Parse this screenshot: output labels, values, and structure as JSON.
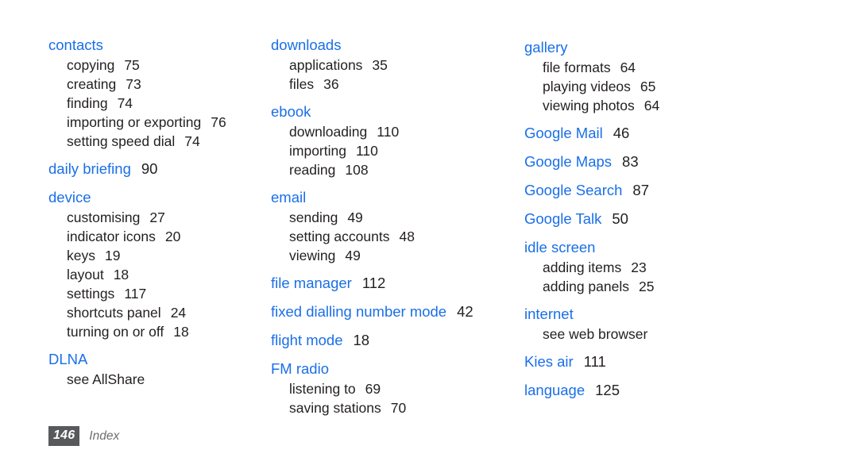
{
  "document": {
    "page_number": "146",
    "section_label": "Index",
    "heading_color": "#1a6fe8",
    "body_color": "#231f20",
    "folio_badge_color": "#58595b",
    "folio_label_color": "#6d6e71",
    "background_color": "#ffffff"
  },
  "columns": [
    {
      "id": "column-1",
      "entries": [
        {
          "type": "heading",
          "label": "contacts",
          "page": ""
        },
        {
          "type": "sub",
          "label": "copying",
          "page": "75"
        },
        {
          "type": "sub",
          "label": "creating",
          "page": "73"
        },
        {
          "type": "sub",
          "label": "finding",
          "page": "74"
        },
        {
          "type": "sub",
          "label": "importing or exporting",
          "page": "76"
        },
        {
          "type": "sub",
          "label": "setting speed dial",
          "page": "74"
        },
        {
          "type": "heading",
          "label": "daily briefing",
          "page": "90"
        },
        {
          "type": "heading",
          "label": "device",
          "page": ""
        },
        {
          "type": "sub",
          "label": "customising",
          "page": "27"
        },
        {
          "type": "sub",
          "label": "indicator icons",
          "page": "20"
        },
        {
          "type": "sub",
          "label": "keys",
          "page": "19"
        },
        {
          "type": "sub",
          "label": "layout",
          "page": "18"
        },
        {
          "type": "sub",
          "label": "settings",
          "page": "117"
        },
        {
          "type": "sub",
          "label": "shortcuts panel",
          "page": "24"
        },
        {
          "type": "sub",
          "label": "turning on or off",
          "page": "18"
        },
        {
          "type": "heading",
          "label": "DLNA",
          "page": ""
        },
        {
          "type": "sub",
          "label": "see AllShare",
          "page": ""
        }
      ]
    },
    {
      "id": "column-2",
      "entries": [
        {
          "type": "heading",
          "label": "downloads",
          "page": ""
        },
        {
          "type": "sub",
          "label": "applications",
          "page": "35"
        },
        {
          "type": "sub",
          "label": "files",
          "page": "36"
        },
        {
          "type": "heading",
          "label": "ebook",
          "page": ""
        },
        {
          "type": "sub",
          "label": "downloading",
          "page": "110"
        },
        {
          "type": "sub",
          "label": "importing",
          "page": "110"
        },
        {
          "type": "sub",
          "label": "reading",
          "page": "108"
        },
        {
          "type": "heading",
          "label": "email",
          "page": ""
        },
        {
          "type": "sub",
          "label": "sending",
          "page": "49"
        },
        {
          "type": "sub",
          "label": "setting accounts",
          "page": "48"
        },
        {
          "type": "sub",
          "label": "viewing",
          "page": "49"
        },
        {
          "type": "heading",
          "label": "file manager",
          "page": "112"
        },
        {
          "type": "heading",
          "label": "fixed dialling number mode",
          "page": "42"
        },
        {
          "type": "heading",
          "label": "flight mode",
          "page": "18"
        },
        {
          "type": "heading",
          "label": "FM radio",
          "page": ""
        },
        {
          "type": "sub",
          "label": "listening to",
          "page": "69"
        },
        {
          "type": "sub",
          "label": "saving stations",
          "page": "70"
        }
      ]
    },
    {
      "id": "column-3",
      "entries": [
        {
          "type": "heading",
          "label": "gallery",
          "page": ""
        },
        {
          "type": "sub",
          "label": "file formats",
          "page": "64"
        },
        {
          "type": "sub",
          "label": "playing videos",
          "page": "65"
        },
        {
          "type": "sub",
          "label": "viewing photos",
          "page": "64"
        },
        {
          "type": "heading",
          "label": "Google Mail",
          "page": "46"
        },
        {
          "type": "heading",
          "label": "Google Maps",
          "page": "83"
        },
        {
          "type": "heading",
          "label": "Google Search",
          "page": "87"
        },
        {
          "type": "heading",
          "label": "Google Talk",
          "page": "50"
        },
        {
          "type": "heading",
          "label": "idle screen",
          "page": ""
        },
        {
          "type": "sub",
          "label": "adding items",
          "page": "23"
        },
        {
          "type": "sub",
          "label": "adding panels",
          "page": "25"
        },
        {
          "type": "heading",
          "label": "internet",
          "page": ""
        },
        {
          "type": "sub",
          "label": "see web browser",
          "page": ""
        },
        {
          "type": "heading",
          "label": "Kies air",
          "page": "111"
        },
        {
          "type": "heading",
          "label": "language",
          "page": "125"
        }
      ]
    }
  ]
}
